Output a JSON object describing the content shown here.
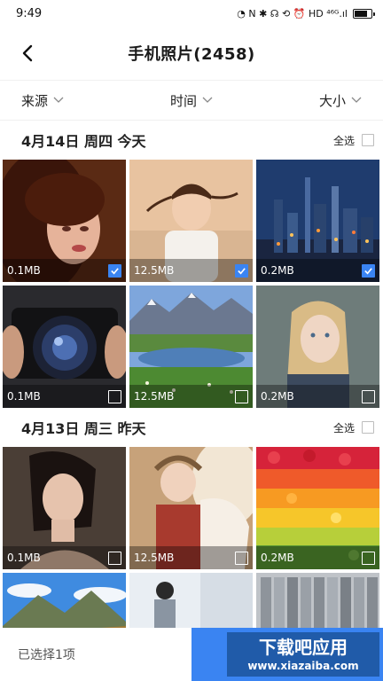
{
  "status": {
    "time": "9:49",
    "icons": "◔ N ✱ ☊ ⟲ ⏰ HD ⁴⁶ᴳ.ıl"
  },
  "header": {
    "title": "手机照片(2458)",
    "back_icon": "back-chevron-icon"
  },
  "filters": [
    {
      "label": "来源"
    },
    {
      "label": "时间"
    },
    {
      "label": "大小"
    }
  ],
  "sections": [
    {
      "title": "4月14日  周四  今天",
      "select_all": "全选",
      "photos": [
        {
          "size": "0.1MB",
          "checked": true,
          "scene": "portrait-dark-hair"
        },
        {
          "size": "12.5MB",
          "checked": true,
          "scene": "child-braids"
        },
        {
          "size": "0.2MB",
          "checked": true,
          "scene": "city-night"
        },
        {
          "size": "0.1MB",
          "checked": false,
          "scene": "camera-lens"
        },
        {
          "size": "12.5MB",
          "checked": false,
          "scene": "mountain-lake"
        },
        {
          "size": "0.2MB",
          "checked": false,
          "scene": "blonde-girl"
        }
      ]
    },
    {
      "title": "4月13日  周三  昨天",
      "select_all": "全选",
      "photos": [
        {
          "size": "0.1MB",
          "checked": false,
          "scene": "woman-portrait"
        },
        {
          "size": "12.5MB",
          "checked": false,
          "scene": "girl-feathers"
        },
        {
          "size": "0.2MB",
          "checked": false,
          "scene": "fruit-rainbow"
        }
      ]
    }
  ],
  "partial_row": [
    {
      "scene": "mountain-sky"
    },
    {
      "scene": "white-room"
    },
    {
      "scene": "grey-books"
    }
  ],
  "footer": {
    "selected_text": "已选择1项"
  },
  "watermark": {
    "line1": "下载吧应用",
    "line2": "www.xiazaiba.com"
  },
  "colors": {
    "accent": "#3a84f2"
  }
}
